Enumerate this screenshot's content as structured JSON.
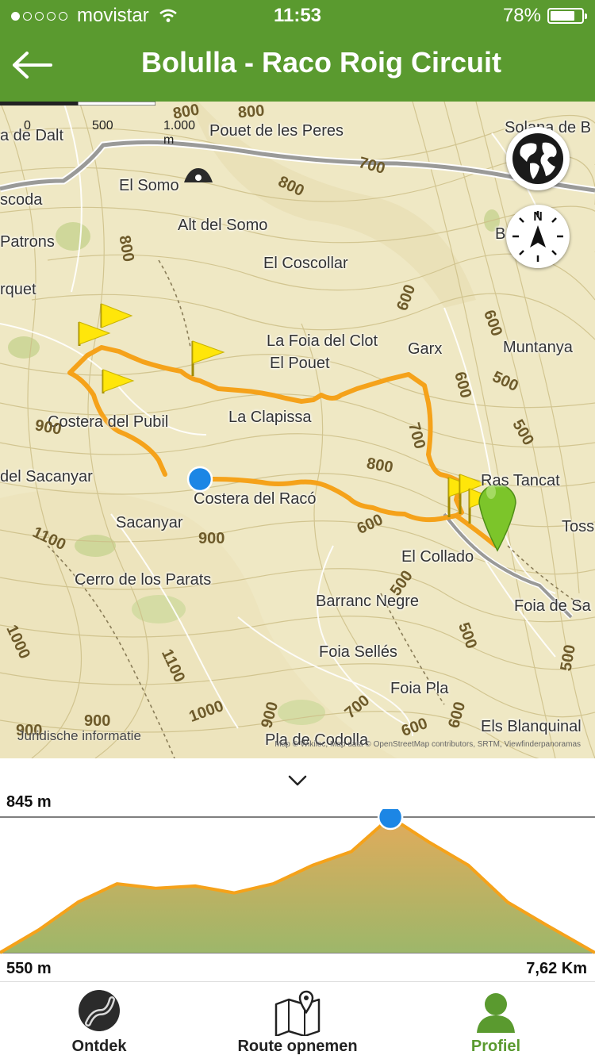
{
  "status_bar": {
    "carrier": "movistar",
    "time": "11:53",
    "battery": "78%",
    "battery_level": 0.78
  },
  "header": {
    "title": "Bolulla - Raco Roig Circuit"
  },
  "map": {
    "scale": {
      "zero": "0",
      "mid": "500",
      "end": "1.000 m"
    },
    "labels": {
      "pouet_peres": "Pouet de les Peres",
      "solana": "Solana de B",
      "a_de_dalt": "a de Dalt",
      "el_somo": "El Somo",
      "scoda": "scoda",
      "alt_del_somo": "Alt del Somo",
      "patrons": "Patrons",
      "el_coscollar": "El Coscollar",
      "rquet": "rquet",
      "foia_clot": "La Foia del Clot",
      "el_pouet": "El Pouet",
      "garx": "Garx",
      "muntanya": "Muntanya",
      "costera_pubil": "Costera del Pubil",
      "la_clapissa": "La Clapissa",
      "del_sacanyar": "del Sacanyar",
      "costera_raco": "Costera del Racó",
      "sacanyar": "Sacanyar",
      "ras_tancat": "Ras Tancat",
      "toss": "Toss",
      "el_collado": "El Collado",
      "cerro_parats": "Cerro de los Parats",
      "barranc_negre": "Barranc Negre",
      "foia_de_sa": "Foia de Sa",
      "foia_selles": "Foia Sellés",
      "foia_pla": "Foia Pla",
      "pla_codolla": "Pla de Codolla",
      "els_blanquinal": "Els Blanquinal",
      "b": "B"
    },
    "contours": [
      "800",
      "800",
      "700",
      "800",
      "800",
      "600",
      "600",
      "500",
      "500",
      "600",
      "700",
      "800",
      "600",
      "900",
      "1100",
      "1000",
      "500",
      "500",
      "900",
      "1100",
      "1000",
      "900",
      "900",
      "900",
      "600",
      "600",
      "500",
      "700"
    ],
    "attribution": "Map © Wikiloc, Map data © OpenStreetMap contributors, SRTM, Viewfinderpanoramas",
    "legal_link": "Juridische informatie",
    "globe_button": "globe-icon",
    "compass_button": "compass-icon",
    "compass_letter": "N",
    "colors": {
      "track": "#f5a21a",
      "marker_blue": "#1c86e5",
      "marker_green": "#7cc52a",
      "flag": "#ffe60a",
      "terrain": "#efe8c4"
    }
  },
  "elevation": {
    "max_label": "845 m",
    "min_label": "550 m",
    "distance_label": "7,62 Km",
    "chart_data": {
      "type": "area",
      "x": [
        0,
        0.5,
        1,
        1.5,
        2,
        2.5,
        3,
        3.5,
        4,
        4.5,
        5,
        5.5,
        6,
        6.5,
        7,
        7.62
      ],
      "y": [
        550,
        600,
        660,
        700,
        690,
        695,
        680,
        700,
        740,
        770,
        845,
        790,
        740,
        660,
        610,
        550
      ],
      "xlim": [
        0,
        7.62
      ],
      "ylim": [
        550,
        845
      ]
    }
  },
  "tabbar": {
    "tabs": [
      {
        "label": "Ontdek",
        "icon": "discover-icon"
      },
      {
        "label": "Route opnemen",
        "icon": "map-pin-icon"
      },
      {
        "label": "Profiel",
        "icon": "profile-icon"
      }
    ]
  }
}
